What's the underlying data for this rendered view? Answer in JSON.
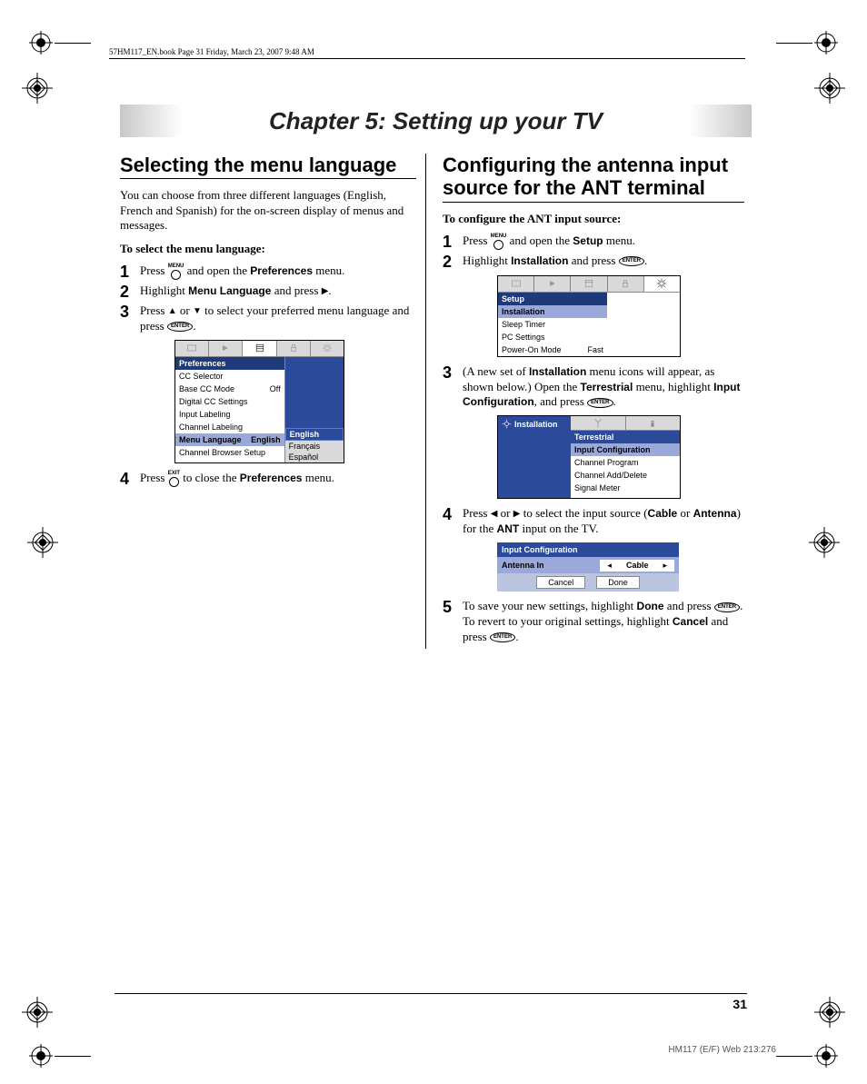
{
  "bookmark": "57HM117_EN.book  Page 31  Friday, March 23, 2007  9:48 AM",
  "chapter_title": "Chapter 5: Setting up your TV",
  "page_number": "31",
  "footer_id": "HM117 (E/F) Web 213:276",
  "left": {
    "heading": "Selecting the menu language",
    "intro": "You can choose from three different languages (English, French and Spanish) for the on-screen display of menus and messages.",
    "subhead": "To select the menu language:",
    "steps": {
      "s1a": "Press ",
      "s1b": " and open the ",
      "s1_bold": "Preferences",
      "s1c": " menu.",
      "s2a": "Highlight ",
      "s2_bold": "Menu Language",
      "s2b": " and press ",
      "s3a": "Press ",
      "s3b": " or ",
      "s3c": " to select your preferred menu language and press ",
      "s4a": "Press ",
      "s4b": " to close the ",
      "s4_bold": "Preferences",
      "s4c": " menu."
    },
    "osd": {
      "title": "Preferences",
      "rows": [
        {
          "l": "CC Selector",
          "r": ""
        },
        {
          "l": "Base CC Mode",
          "r": "Off"
        },
        {
          "l": "Digital CC Settings",
          "r": ""
        },
        {
          "l": "Input Labeling",
          "r": ""
        },
        {
          "l": "Channel Labeling",
          "r": ""
        },
        {
          "l": "Menu Language",
          "r": "English",
          "sel": true
        },
        {
          "l": "Channel Browser Setup",
          "r": ""
        }
      ],
      "options": [
        "English",
        "Français",
        "Español"
      ]
    },
    "menu_label": "MENU",
    "exit_label": "EXIT",
    "enter_label": "ENTER"
  },
  "right": {
    "heading": "Configuring the antenna input source for the ANT terminal",
    "subhead": "To configure the ANT input source:",
    "steps": {
      "s1a": "Press ",
      "s1b": " and open the ",
      "s1_bold": "Setup",
      "s1c": " menu.",
      "s2a": "Highlight ",
      "s2_bold": "Installation",
      "s2b": " and press ",
      "s3a": "(A new set of ",
      "s3_bold1": "Installation",
      "s3b": " menu icons will appear, as shown below.) Open the ",
      "s3_bold2": "Terrestrial",
      "s3c": " menu, highlight ",
      "s3_bold3": "Input Configuration",
      "s3d": ", and press ",
      "s4a": "Press ",
      "s4b": " or ",
      "s4c": " to select the input source (",
      "s4_bold1": "Cable",
      "s4d": " or ",
      "s4_bold2": "Antenna",
      "s4e": ") for the ",
      "s4_bold3": "ANT",
      "s4f": " input on the TV.",
      "s5a": "To save your new settings, highlight ",
      "s5_bold1": "Done",
      "s5b": " and press ",
      "s5c": ". To revert to your original settings, highlight ",
      "s5_bold2": "Cancel",
      "s5d": " and press "
    },
    "osd_setup": {
      "title": "Setup",
      "rows": [
        {
          "l": "Installation",
          "r": "",
          "sel": true
        },
        {
          "l": "Sleep Timer",
          "r": ""
        },
        {
          "l": "PC Settings",
          "r": ""
        },
        {
          "l": "Power-On Mode",
          "r": "Fast"
        }
      ]
    },
    "osd_install": {
      "tab_active": "Installation",
      "header": "Terrestrial",
      "rows": [
        {
          "l": "Input Configuration",
          "sel": true
        },
        {
          "l": "Channel Program"
        },
        {
          "l": "Channel Add/Delete"
        },
        {
          "l": "Signal Meter"
        }
      ]
    },
    "osd_input": {
      "header": "Input Configuration",
      "row_label": "Antenna In",
      "row_value": "Cable",
      "btn_cancel": "Cancel",
      "btn_done": "Done"
    }
  }
}
